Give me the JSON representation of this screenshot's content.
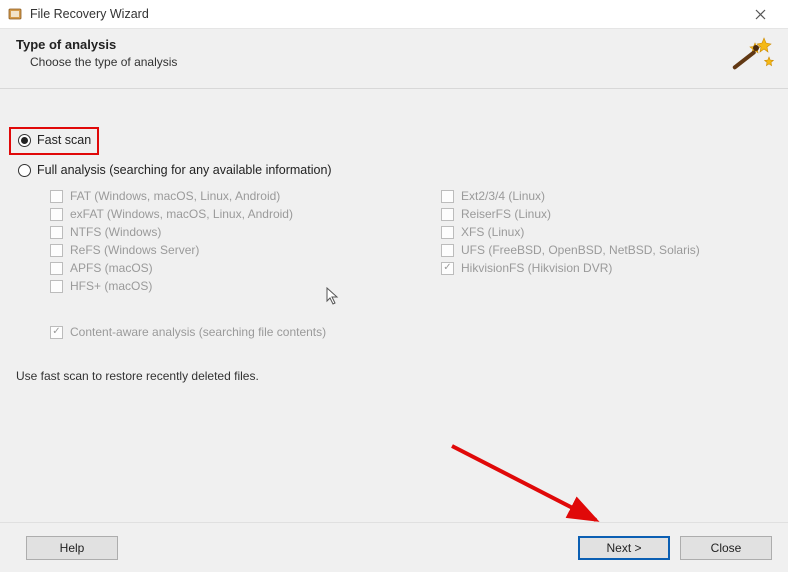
{
  "window": {
    "title": "File Recovery Wizard"
  },
  "header": {
    "title": "Type of analysis",
    "subtitle": "Choose the type of analysis"
  },
  "scan": {
    "fast_scan": {
      "label": "Fast scan",
      "selected": true
    },
    "full_analysis": {
      "label": "Full analysis (searching for any available information)",
      "selected": false
    }
  },
  "fs": {
    "left": [
      {
        "label": "FAT (Windows, macOS, Linux, Android)",
        "checked": false
      },
      {
        "label": "exFAT (Windows, macOS, Linux, Android)",
        "checked": false
      },
      {
        "label": "NTFS (Windows)",
        "checked": false
      },
      {
        "label": "ReFS (Windows Server)",
        "checked": false
      },
      {
        "label": "APFS (macOS)",
        "checked": false
      },
      {
        "label": "HFS+ (macOS)",
        "checked": false
      }
    ],
    "right": [
      {
        "label": "Ext2/3/4 (Linux)",
        "checked": false
      },
      {
        "label": "ReiserFS (Linux)",
        "checked": false
      },
      {
        "label": "XFS (Linux)",
        "checked": false
      },
      {
        "label": "UFS (FreeBSD, OpenBSD, NetBSD, Solaris)",
        "checked": false
      },
      {
        "label": "HikvisionFS (Hikvision DVR)",
        "checked": true
      }
    ]
  },
  "content_aware": {
    "label": "Content-aware analysis (searching file contents)",
    "checked": true
  },
  "hint": "Use fast scan to restore recently deleted files.",
  "buttons": {
    "help": "Help",
    "next": "Next >",
    "close": "Close"
  },
  "colors": {
    "highlight": "#e00909",
    "primary_border": "#0b5fb3"
  }
}
